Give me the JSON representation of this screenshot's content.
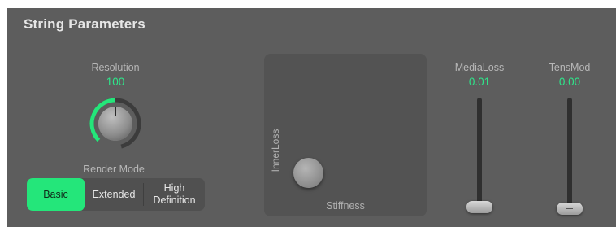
{
  "title": "String Parameters",
  "resolution": {
    "label": "Resolution",
    "value": "100",
    "level": 0.5
  },
  "render_mode": {
    "label": "Render Mode",
    "options": [
      "Basic",
      "Extended",
      "High Definition"
    ],
    "selected": "Basic"
  },
  "xy_pad": {
    "y_label": "InnerLoss",
    "x_label": "Stiffness"
  },
  "media_loss": {
    "label": "MediaLoss",
    "value": "0.01"
  },
  "tens_mod": {
    "label": "TensMod",
    "value": "0.00"
  },
  "colors": {
    "accent": "#24e67a",
    "panel": "#5d5d5d",
    "label": "#b7b7b7"
  }
}
